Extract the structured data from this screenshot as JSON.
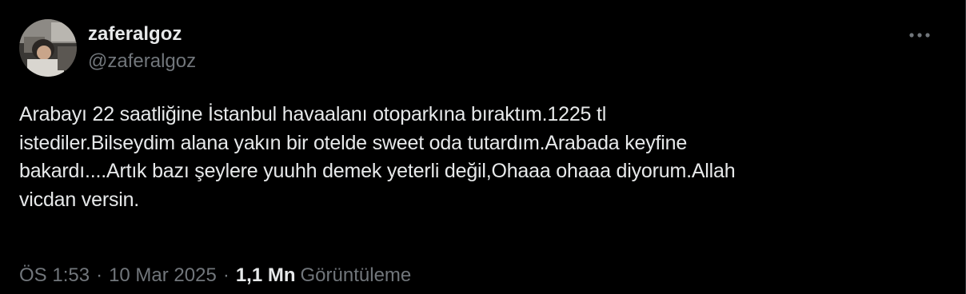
{
  "user": {
    "display_name": "zaferalgoz",
    "handle": "@zaferalgoz"
  },
  "tweet": {
    "text": "Arabayı 22 saatliğine İstanbul havaalanı otoparkına bıraktım.1225 tl\nistediler.Bilseydim alana yakın bir otelde sweet oda tutardım.Arabada keyfine\nbakardı....Artık bazı şeylere yuuhh demek yeterli değil,Ohaaa ohaaa diyorum.Allah\nvicdan versin."
  },
  "meta": {
    "time": "ÖS 1:53",
    "separator": "·",
    "date": "10 Mar 2025",
    "separator2": "·",
    "views_count": "1,1 Mn",
    "views_label": "Görüntüleme"
  },
  "icons": {
    "more": "more-horizontal-icon"
  },
  "colors": {
    "background": "#000000",
    "text_primary": "#e7e9ea",
    "text_secondary": "#71767b",
    "border": "#2f3336"
  }
}
